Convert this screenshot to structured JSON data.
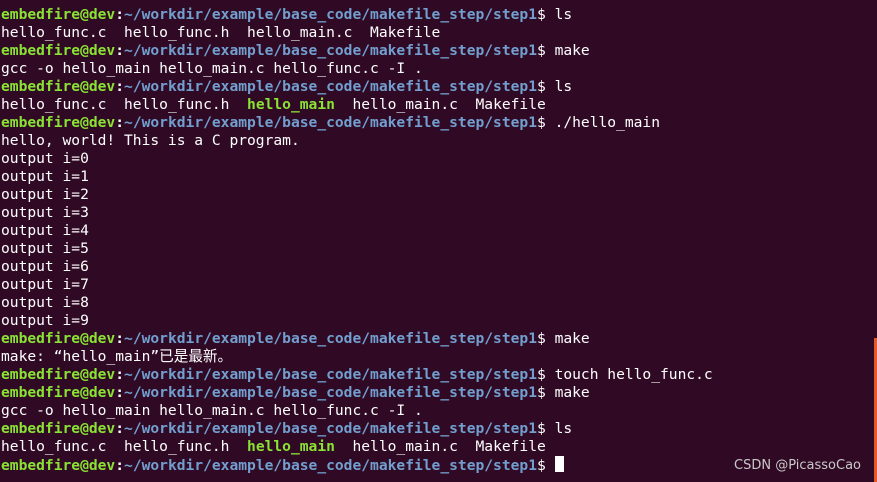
{
  "terminal": {
    "lines": [
      {
        "type": "prompt",
        "user": "embedfire@dev",
        "path": "~/workdir/example/base_code/makefile_step/step1",
        "cmd": "ls"
      },
      {
        "type": "files",
        "items": [
          {
            "text": "hello_func.c",
            "exec": false
          },
          {
            "text": "hello_func.h",
            "exec": false
          },
          {
            "text": "hello_main.c",
            "exec": false
          },
          {
            "text": "Makefile",
            "exec": false
          }
        ]
      },
      {
        "type": "prompt",
        "user": "embedfire@dev",
        "path": "~/workdir/example/base_code/makefile_step/step1",
        "cmd": "make"
      },
      {
        "type": "output",
        "text": "gcc -o hello_main hello_main.c hello_func.c -I ."
      },
      {
        "type": "prompt",
        "user": "embedfire@dev",
        "path": "~/workdir/example/base_code/makefile_step/step1",
        "cmd": "ls"
      },
      {
        "type": "files",
        "items": [
          {
            "text": "hello_func.c",
            "exec": false
          },
          {
            "text": "hello_func.h",
            "exec": false
          },
          {
            "text": "hello_main",
            "exec": true
          },
          {
            "text": "hello_main.c",
            "exec": false
          },
          {
            "text": "Makefile",
            "exec": false
          }
        ]
      },
      {
        "type": "prompt",
        "user": "embedfire@dev",
        "path": "~/workdir/example/base_code/makefile_step/step1",
        "cmd": "./hello_main"
      },
      {
        "type": "output",
        "text": "hello, world! This is a C program."
      },
      {
        "type": "output",
        "text": "output i=0"
      },
      {
        "type": "output",
        "text": "output i=1"
      },
      {
        "type": "output",
        "text": "output i=2"
      },
      {
        "type": "output",
        "text": "output i=3"
      },
      {
        "type": "output",
        "text": "output i=4"
      },
      {
        "type": "output",
        "text": "output i=5"
      },
      {
        "type": "output",
        "text": "output i=6"
      },
      {
        "type": "output",
        "text": "output i=7"
      },
      {
        "type": "output",
        "text": "output i=8"
      },
      {
        "type": "output",
        "text": "output i=9"
      },
      {
        "type": "prompt",
        "user": "embedfire@dev",
        "path": "~/workdir/example/base_code/makefile_step/step1",
        "cmd": "make"
      },
      {
        "type": "output",
        "text": "make: “hello_main”已是最新。"
      },
      {
        "type": "prompt",
        "user": "embedfire@dev",
        "path": "~/workdir/example/base_code/makefile_step/step1",
        "cmd": "touch hello_func.c"
      },
      {
        "type": "prompt",
        "user": "embedfire@dev",
        "path": "~/workdir/example/base_code/makefile_step/step1",
        "cmd": "make"
      },
      {
        "type": "output",
        "text": "gcc -o hello_main hello_main.c hello_func.c -I ."
      },
      {
        "type": "prompt",
        "user": "embedfire@dev",
        "path": "~/workdir/example/base_code/makefile_step/step1",
        "cmd": "ls"
      },
      {
        "type": "files",
        "items": [
          {
            "text": "hello_func.c",
            "exec": false
          },
          {
            "text": "hello_func.h",
            "exec": false
          },
          {
            "text": "hello_main",
            "exec": true
          },
          {
            "text": "hello_main.c",
            "exec": false
          },
          {
            "text": "Makefile",
            "exec": false
          }
        ]
      },
      {
        "type": "prompt",
        "user": "embedfire@dev",
        "path": "~/workdir/example/base_code/makefile_step/step1",
        "cmd": "",
        "cursor": true
      }
    ]
  },
  "watermark": "CSDN @PicassoCao",
  "colors": {
    "background": "#300a24",
    "user": "#8ae234",
    "path": "#729fcf",
    "text": "#ffffff",
    "executable": "#8ae234",
    "scrollbar": "#e25a2a"
  }
}
